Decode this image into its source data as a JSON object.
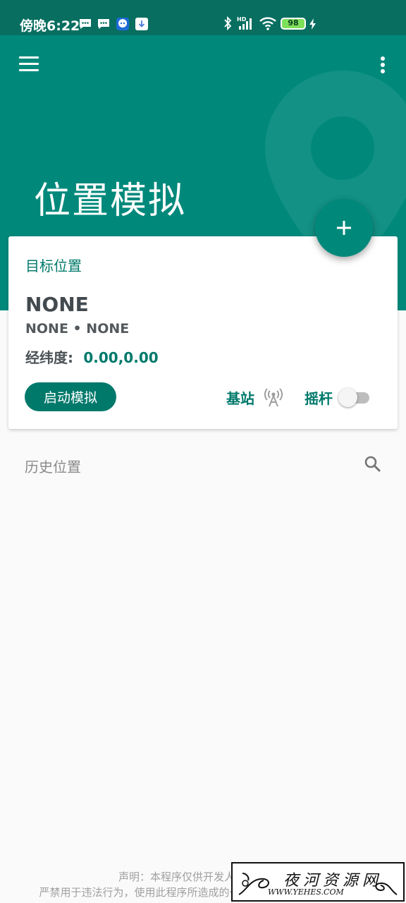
{
  "status_bar": {
    "time": "傍晚6:22",
    "battery": "98",
    "icons": [
      "message-icon",
      "message-icon",
      "robot-app-icon",
      "download-icon",
      "bluetooth-icon",
      "hd-signal-icon",
      "wifi-icon",
      "battery-icon",
      "charging-icon"
    ]
  },
  "header": {
    "title": "位置模拟",
    "menu_icon": "hamburger-menu-icon",
    "more_icon": "more-vertical-icon",
    "fab_icon": "plus-icon"
  },
  "card": {
    "section_label": "目标位置",
    "location_name": "NONE",
    "location_sub": "NONE • NONE",
    "coord_label": "经纬度:",
    "coord_value": "0.00,0.00",
    "start_button": "启动模拟",
    "cell_label": "基站",
    "cell_icon": "cell-tower-icon",
    "joystick_label": "摇杆",
    "joystick_enabled": false
  },
  "history": {
    "title": "历史位置",
    "search_icon": "search-icon"
  },
  "disclaimer": {
    "line1": "声明：本程序仅供开发人员测试使用",
    "line2": "严禁用于违法行为，使用此程序所造成的一切后果由使用者自行承担！"
  },
  "watermark": {
    "cn": "夜河资源网",
    "en": "WWW.YEHES.COM"
  },
  "colors": {
    "primary": "#00897b",
    "primary_dark": "#00796b",
    "status_bar": "#076e60",
    "background": "#fafafa"
  }
}
